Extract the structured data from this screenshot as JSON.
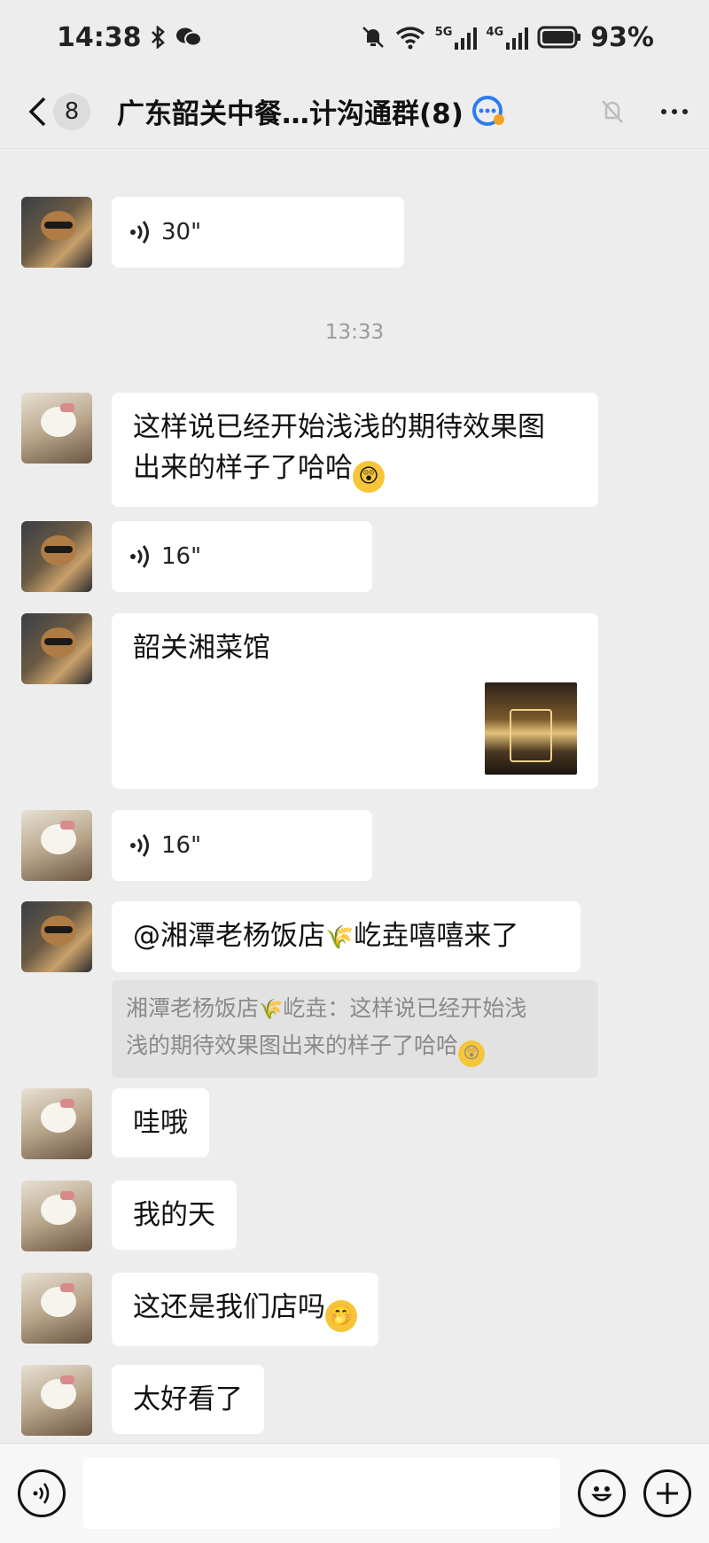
{
  "status_bar": {
    "time": "14:38",
    "battery": "93%",
    "network_5g": "5G",
    "network_4g": "4G"
  },
  "nav": {
    "unread_count": "8",
    "title": "广东韶关中餐…计沟通群(8)"
  },
  "chat": {
    "timestamp": "13:33",
    "messages": [
      {
        "type": "voice",
        "duration": "30\""
      },
      {
        "type": "text",
        "line1": "这样说已经开始浅浅的期待效果图",
        "line2": "出来的样子了哈哈"
      },
      {
        "type": "voice",
        "duration": "16\""
      },
      {
        "type": "link",
        "title": "韶关湘菜馆"
      },
      {
        "type": "voice",
        "duration": "16\""
      },
      {
        "type": "mention",
        "prefix": "@湘潭老杨饭店",
        "suffix": "屹垚嘻嘻来了"
      },
      {
        "type": "text",
        "text": "哇哦"
      },
      {
        "type": "text",
        "text": "我的天"
      },
      {
        "type": "text",
        "text": "这还是我们店吗"
      },
      {
        "type": "text",
        "text": "太好看了"
      }
    ],
    "quote": {
      "line1_prefix": "湘潭老杨饭店",
      "line1_suffix": "屹垚：这样说已经开始浅",
      "line2": "浅的期待效果图出来的样子了哈哈"
    }
  },
  "icons": {
    "voice": "voice-wave-icon",
    "emoji": "emoji-icon",
    "plus": "plus-icon",
    "back": "chevron-left-icon",
    "mute": "bell-muted-icon",
    "more": "more-icon"
  }
}
